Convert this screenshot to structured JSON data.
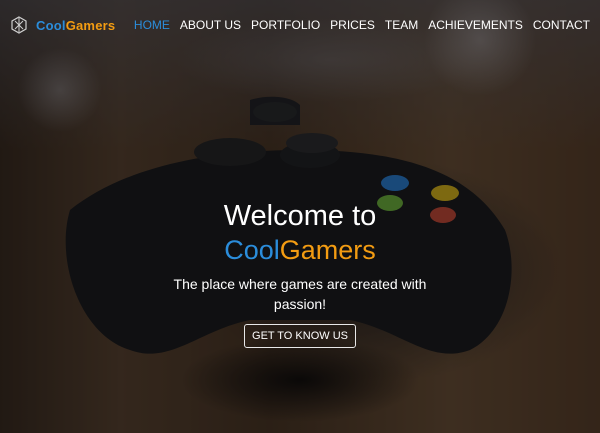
{
  "brand": {
    "part1": "Cool",
    "part2": "Gamers"
  },
  "nav": {
    "items": [
      {
        "label": "HOME",
        "active": true
      },
      {
        "label": "ABOUT US",
        "active": false
      },
      {
        "label": "PORTFOLIO",
        "active": false
      },
      {
        "label": "PRICES",
        "active": false
      },
      {
        "label": "TEAM",
        "active": false
      },
      {
        "label": "ACHIEVEMENTS",
        "active": false
      },
      {
        "label": "CONTACT",
        "active": false
      }
    ]
  },
  "hero": {
    "title_line1": "Welcome to",
    "title_part1": "Cool",
    "title_part2": "Gamers",
    "tagline": "The place where games are created with passion!",
    "cta_label": "GET TO KNOW US",
    "background": "game-controller-photo"
  },
  "colors": {
    "accent_blue": "#2b8ddb",
    "accent_orange": "#f39c12"
  }
}
